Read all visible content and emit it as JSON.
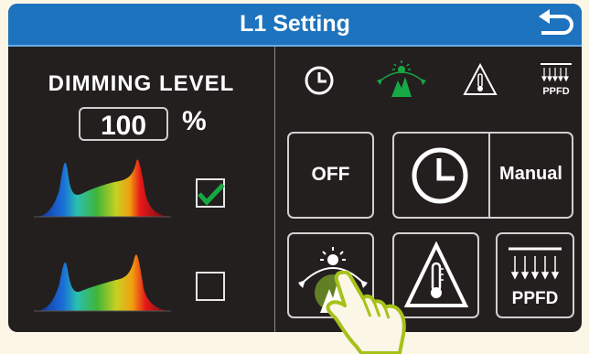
{
  "header": {
    "title": "L1 Setting"
  },
  "dimming": {
    "label": "DIMMING LEVEL",
    "value": "100",
    "unit": "%"
  },
  "spectra": [
    {
      "checked": true
    },
    {
      "checked": false
    }
  ],
  "mode_icons": {
    "ppfd_label": "PPFD"
  },
  "buttons": {
    "off_label": "OFF",
    "manual_label": "Manual",
    "ppfd_label": "PPFD"
  },
  "colors": {
    "title_bar": "#1d73bd",
    "check": "#17a844",
    "panel": "#231f1f",
    "sunrise_icon": "#18a846"
  }
}
